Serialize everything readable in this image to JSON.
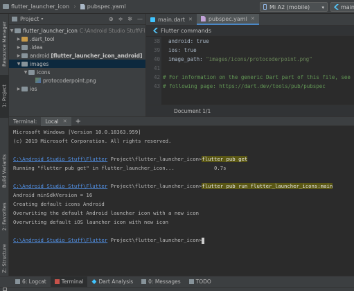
{
  "navbar": {
    "project_name": "flutter_launcher_icon",
    "file_name": "pubspec.yaml",
    "device": "Mi A2 (mobile)",
    "run_config": "main.dart"
  },
  "left_stripe": [
    "1: Project",
    "Resource Manager",
    "Build Variants",
    "2: Favorites",
    "Z: Structure"
  ],
  "project_panel": {
    "title": "Project",
    "tree": [
      {
        "name": "flutter_launcher_icon",
        "path": "C:\\Android Studio Stuff\\Flutter"
      },
      {
        "name": ".dart_tool"
      },
      {
        "name": ".idea"
      },
      {
        "name": "android",
        "module": "[flutter_launcher_icon_android]"
      },
      {
        "name": "images"
      },
      {
        "name": "icons"
      },
      {
        "name": "protocoderpoint.png"
      },
      {
        "name": "ios"
      }
    ]
  },
  "editor": {
    "tabs": [
      {
        "label": "main.dart"
      },
      {
        "label": "pubspec.yaml"
      }
    ],
    "commands_label": "Flutter commands",
    "lines": [
      {
        "num": "38",
        "text": "android: true"
      },
      {
        "num": "39",
        "text": "ios: true"
      },
      {
        "num": "40",
        "key": "image_path: ",
        "value": "\"images/icons/protocoderpoint.png\""
      },
      {
        "num": "41",
        "text": ""
      },
      {
        "num": "42",
        "text": "# For information on the generic Dart part of this file, see th"
      },
      {
        "num": "43",
        "text": "# following page: https://dart.dev/tools/pub/pubspec"
      }
    ],
    "doc_label": "Document 1/1"
  },
  "terminal": {
    "label": "Terminal:",
    "tab": "Local",
    "lines": [
      {
        "text": "Microsoft Windows [Version 10.0.18363.959]"
      },
      {
        "text": "(c) 2019 Microsoft Corporation. All rights reserved."
      },
      {
        "text": ""
      },
      {
        "link": "C:\\Android Studio Stuff\\Flutter",
        "rest": " Project\\flutter_launcher_icon>",
        "cmd": "flutter pub get"
      },
      {
        "text": "Running \"flutter pub get\" in flutter_launcher_icon...             0.7s"
      },
      {
        "text": ""
      },
      {
        "link": "C:\\Android Studio Stuff\\Flutter",
        "rest": " Project\\flutter_launcher_icon>",
        "cmd": "flutter pub run flutter_launcher_icons:main"
      },
      {
        "text": "Android minSdkVersion = 16"
      },
      {
        "text": "Creating default icons Android"
      },
      {
        "text": "Overwriting the default Android launcher icon with a new icon"
      },
      {
        "text": "Overwriting default iOS launcher icon with new icon"
      },
      {
        "text": ""
      },
      {
        "link": "C:\\Android Studio Stuff\\Flutter",
        "rest": " Project\\flutter_launcher_icon>",
        "cursor": true
      }
    ]
  },
  "bottom_tabs": [
    {
      "label": "6: Logcat"
    },
    {
      "label": "Terminal"
    },
    {
      "label": "Dart Analysis"
    },
    {
      "label": "0: Messages"
    },
    {
      "label": "TODO"
    }
  ],
  "colors": {
    "background": "#2b2b2b",
    "panel": "#3c3f41",
    "link": "#5394ec",
    "highlight": "#5a5714",
    "string": "#6a8759",
    "comment": "#629755"
  }
}
